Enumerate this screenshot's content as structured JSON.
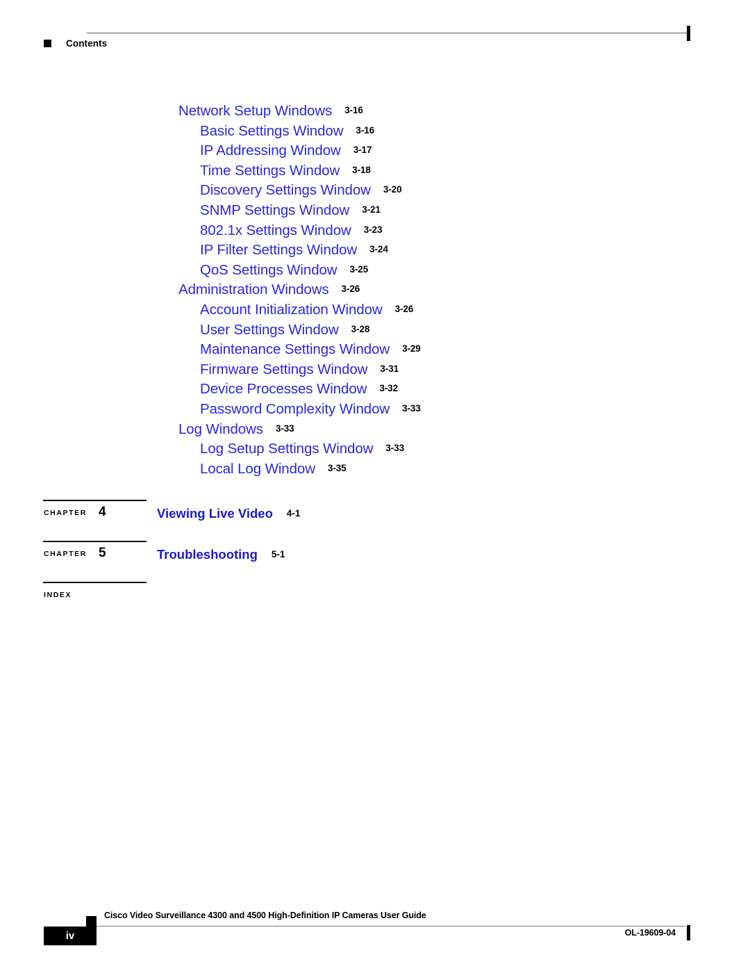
{
  "header": {
    "label": "Contents",
    "square_icon": "black-square-bullet-icon"
  },
  "toc": {
    "entries": [
      {
        "level": 1,
        "title": "Network Setup Windows",
        "page": "3-16"
      },
      {
        "level": 2,
        "title": "Basic Settings Window",
        "page": "3-16"
      },
      {
        "level": 2,
        "title": "IP Addressing Window",
        "page": "3-17"
      },
      {
        "level": 2,
        "title": "Time Settings Window",
        "page": "3-18"
      },
      {
        "level": 2,
        "title": "Discovery Settings Window",
        "page": "3-20"
      },
      {
        "level": 2,
        "title": "SNMP Settings Window",
        "page": "3-21"
      },
      {
        "level": 2,
        "title": "802.1x Settings Window",
        "page": "3-23"
      },
      {
        "level": 2,
        "title": "IP Filter Settings Window",
        "page": "3-24"
      },
      {
        "level": 2,
        "title": "QoS Settings Window",
        "page": "3-25"
      },
      {
        "level": 1,
        "title": "Administration Windows",
        "page": "3-26"
      },
      {
        "level": 2,
        "title": "Account Initialization Window",
        "page": "3-26"
      },
      {
        "level": 2,
        "title": "User Settings Window",
        "page": "3-28"
      },
      {
        "level": 2,
        "title": "Maintenance Settings Window",
        "page": "3-29"
      },
      {
        "level": 2,
        "title": "Firmware Settings Window",
        "page": "3-31"
      },
      {
        "level": 2,
        "title": "Device Processes Window",
        "page": "3-32"
      },
      {
        "level": 2,
        "title": "Password Complexity Window",
        "page": "3-33"
      },
      {
        "level": 1,
        "title": "Log Windows",
        "page": "3-33"
      },
      {
        "level": 2,
        "title": "Log Setup Settings Window",
        "page": "3-33"
      },
      {
        "level": 2,
        "title": "Local Log Window",
        "page": "3-35"
      }
    ]
  },
  "chapters": [
    {
      "word": "CHAPTER",
      "number": "4",
      "title": "Viewing Live Video",
      "page": "4-1"
    },
    {
      "word": "CHAPTER",
      "number": "5",
      "title": "Troubleshooting",
      "page": "5-1"
    }
  ],
  "index": {
    "word": "INDEX"
  },
  "footer": {
    "page_number": "iv",
    "title": "Cisco Video Surveillance 4300 and 4500 High-Definition IP Cameras User Guide",
    "doc_id": "OL-19609-04"
  },
  "colors": {
    "toc_link": "#2727e8",
    "chapter_title": "#1919d6",
    "text": "#000000",
    "rule": "#7a7a7a"
  }
}
